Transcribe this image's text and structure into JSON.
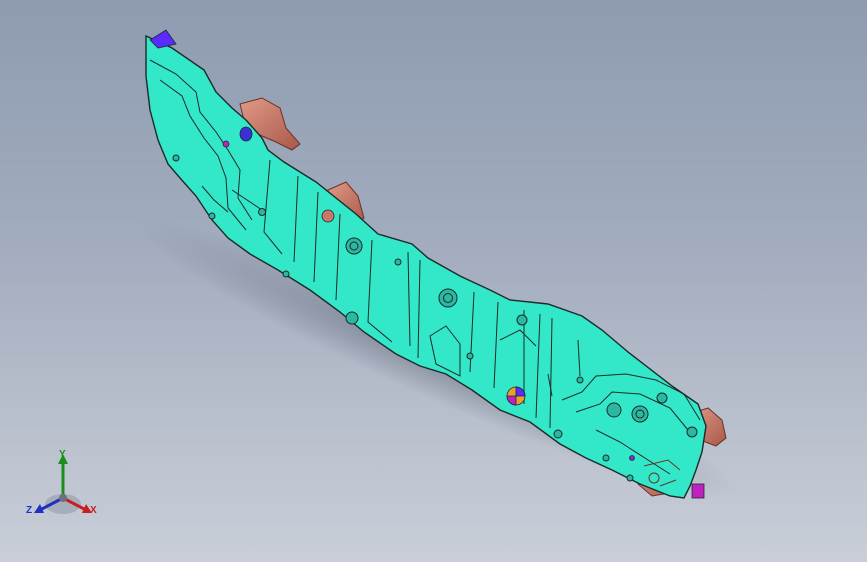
{
  "viewport": {
    "background_top": "#8e9bb0",
    "background_bottom": "#c9ced8"
  },
  "model": {
    "part_color": "#33e8c8",
    "edge_color": "#1d2a2a",
    "bracket_color": "#c87868",
    "accent_colors": [
      "#5a2aff",
      "#c020c0",
      "#e8a030"
    ]
  },
  "triad": {
    "x_label": "X",
    "y_label": "Y",
    "z_label": "Z",
    "x_color": "#c82020",
    "y_color": "#1a8f1a",
    "z_color": "#2030c0"
  }
}
